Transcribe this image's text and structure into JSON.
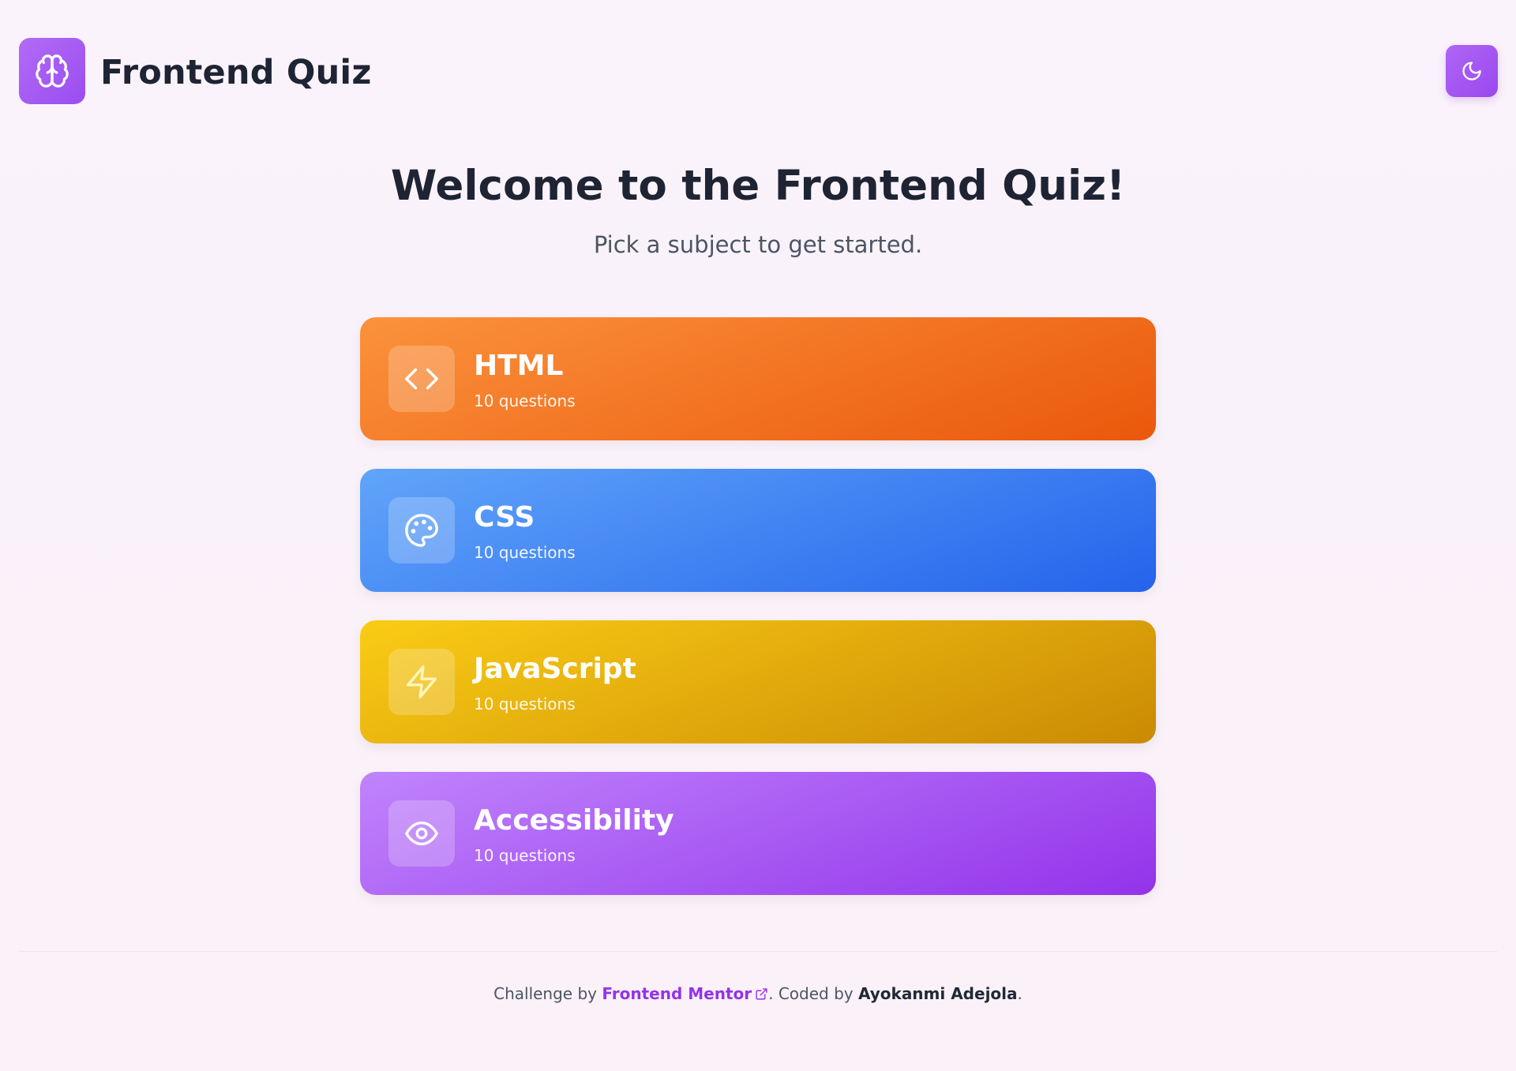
{
  "header": {
    "app_title": "Frontend Quiz",
    "logo_icon": "brain-icon",
    "theme_toggle_icon": "moon-icon"
  },
  "welcome": {
    "title": "Welcome to the Frontend Quiz!",
    "subtitle": "Pick a subject to get started."
  },
  "subjects": [
    {
      "name": "HTML",
      "count": "10 questions",
      "icon": "code-icon",
      "color": "#f97316"
    },
    {
      "name": "CSS",
      "count": "10 questions",
      "icon": "palette-icon",
      "color": "#3b82f6"
    },
    {
      "name": "JavaScript",
      "count": "10 questions",
      "icon": "lightning-icon",
      "color": "#eab308"
    },
    {
      "name": "Accessibility",
      "count": "10 questions",
      "icon": "eye-icon",
      "color": "#a855f7"
    }
  ],
  "footer": {
    "prefix": "Challenge by ",
    "link_text": "Frontend Mentor",
    "link_icon": "external-link-icon",
    "middle": ". Coded by ",
    "author": "Ayokanmi Adejola",
    "suffix": "."
  }
}
